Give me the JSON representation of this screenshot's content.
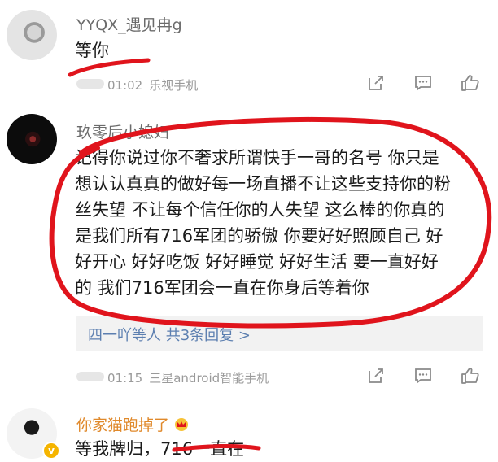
{
  "comments": [
    {
      "username": "YYQX_遇见冉g",
      "text": "等你",
      "time": "01:02",
      "device": "乐视手机"
    },
    {
      "username": "玖零后小媳妇",
      "text_lines": [
        "记得你说过你不奢求所谓快手一哥的名号 你只是",
        "想认认真真的做好每一场直播不让这些支持你的粉",
        "丝失望 不让每个信任你的人失望 这么棒的你真的",
        "是我们所有716军团的骄傲 你要好好照顾自己 好",
        "好开心 好好吃饭 好好睡觉 好好生活 要一直好好",
        "的 我们716军团会一直在你身后等着你"
      ],
      "reply_link": "四一吖等人 共3条回复 >",
      "time": "01:15",
      "device": "三星android智能手机"
    },
    {
      "username": "你家猫跑掉了",
      "text": "等我牌归，716一直在"
    }
  ],
  "icons": {
    "share": "share-icon",
    "comment": "comment-icon",
    "like": "thumbs-up-icon",
    "crown": "crown-badge-icon",
    "verified": "verified-v-icon"
  },
  "colors": {
    "annotation_red": "#e0141c",
    "username_gray": "#6b6b6b",
    "username_gold": "#e0892b",
    "meta_gray": "#9a9a9a",
    "link_blue": "#5c7fb0",
    "badge_gold": "#f5b400"
  }
}
